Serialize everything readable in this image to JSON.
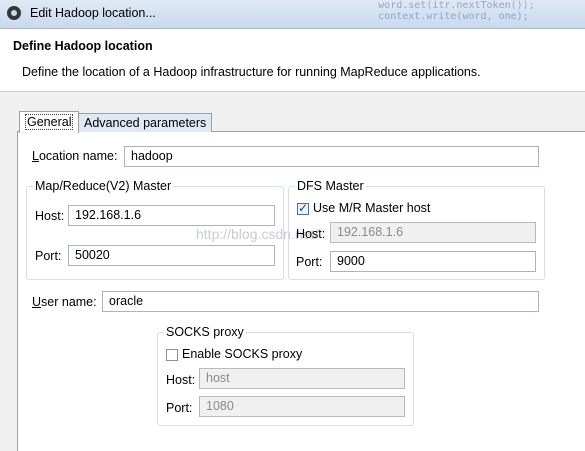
{
  "window": {
    "title": "Edit Hadoop location...",
    "background_code": "        word.set(itr.nextToken());\n        context.write(word, one);"
  },
  "header": {
    "title": "Define Hadoop location",
    "description": "Define the location of a Hadoop infrastructure for running MapReduce applications."
  },
  "tabs": [
    {
      "label": "General",
      "selected": true
    },
    {
      "label": "Advanced parameters",
      "selected": false
    }
  ],
  "general": {
    "location_name": {
      "label_u": "L",
      "label_rest": "ocation name:",
      "value": "hadoop"
    },
    "mr_master": {
      "title": "Map/Reduce(V2) Master",
      "host_label": "Host:",
      "host_value": "192.168.1.6",
      "port_label": "Port:",
      "port_value": "50020"
    },
    "dfs_master": {
      "title": "DFS Master",
      "use_mr_label": "Use M/R Master host",
      "use_mr_checked": true,
      "host_label": "Host:",
      "host_value": "192.168.1.6",
      "port_label": "Port:",
      "port_value": "9000"
    },
    "user_name": {
      "label_u": "U",
      "label_rest": "ser name:",
      "value": "oracle"
    },
    "socks": {
      "title": "SOCKS proxy",
      "enable_label": "Enable SOCKS proxy",
      "enable_checked": false,
      "host_label": "Host:",
      "host_value": "host",
      "port_label": "Port:",
      "port_value": "1080"
    }
  },
  "watermark": "http://blog.csdn.net/"
}
